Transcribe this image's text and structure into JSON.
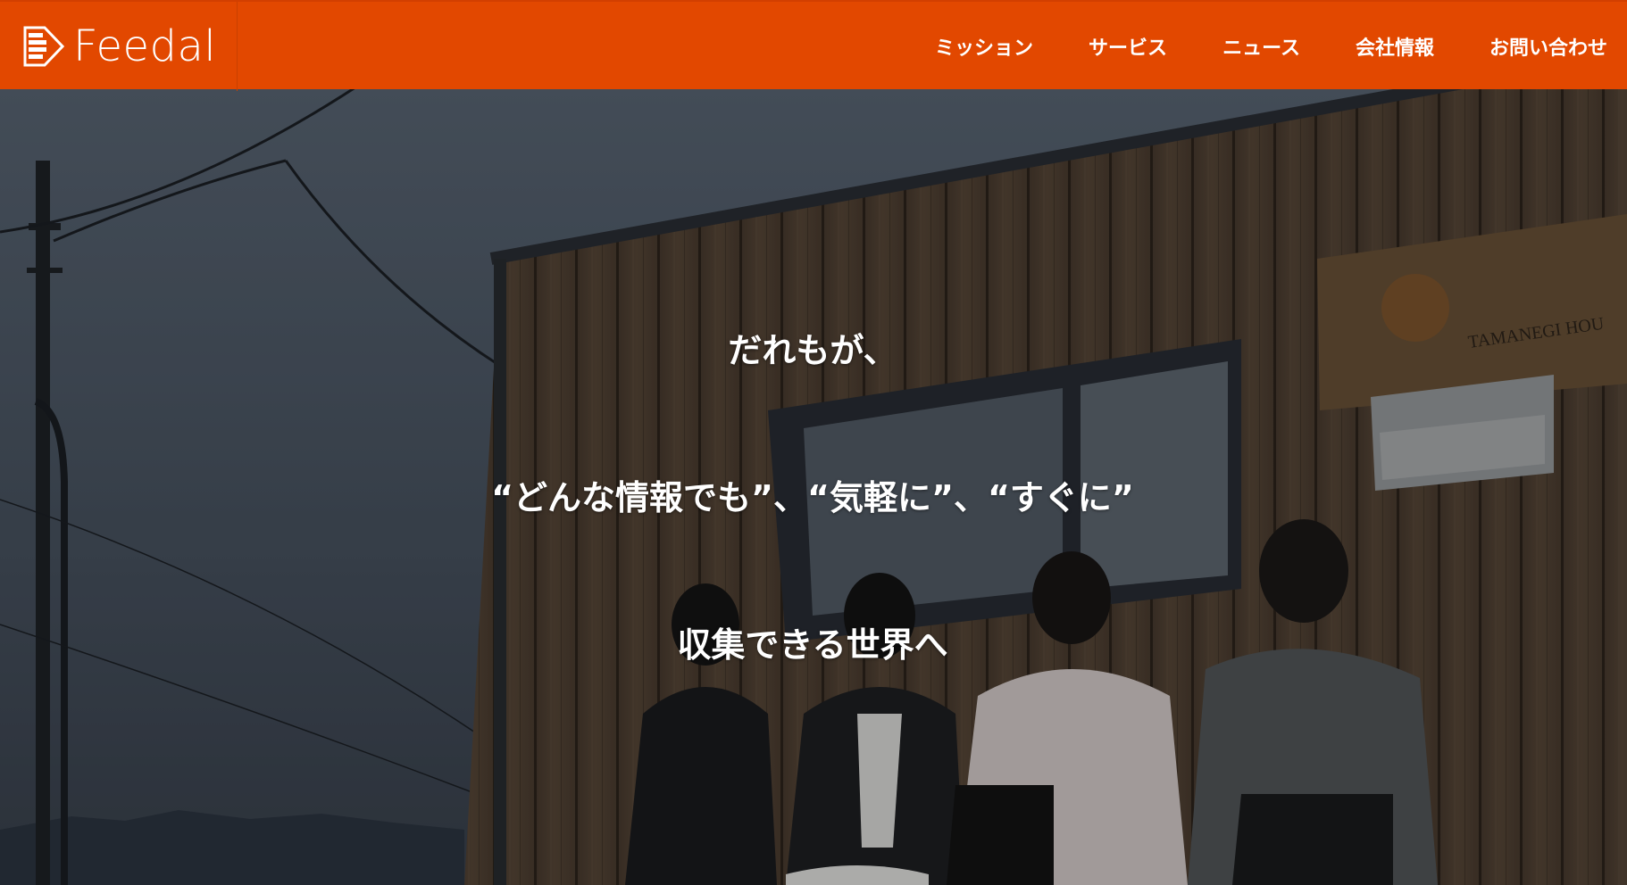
{
  "header": {
    "logo_text": "Feedal",
    "nav": [
      {
        "label": "ミッション"
      },
      {
        "label": "サービス"
      },
      {
        "label": "ニュース"
      },
      {
        "label": "会社情報"
      },
      {
        "label": "お問い合わせ"
      }
    ],
    "colors": {
      "header_bg": "#e24800"
    }
  },
  "hero": {
    "lines": [
      "だれもが、",
      "“どんな情報でも”、“気軽に”、“すぐに”",
      "収集できる世界へ"
    ],
    "sign_text": "TAMANEGI HOU"
  }
}
